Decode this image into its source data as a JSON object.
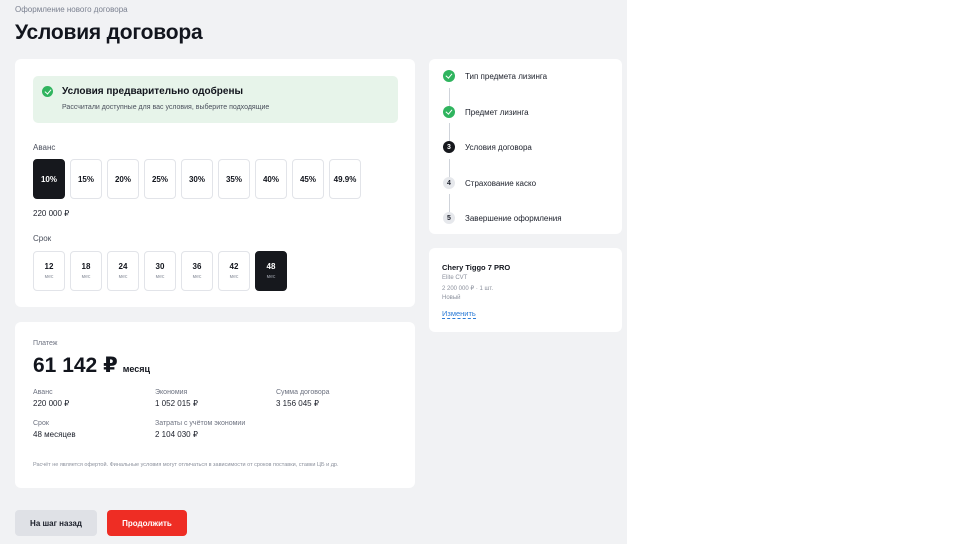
{
  "breadcrumb": "Оформление нового договора",
  "page_title": "Условия договора",
  "approval": {
    "title": "Условия предварительно одобрены",
    "subtitle": "Рассчитали доступные для вас условия, выберите подходящие"
  },
  "advance": {
    "label": "Аванс",
    "options": [
      "10%",
      "15%",
      "20%",
      "25%",
      "30%",
      "35%",
      "40%",
      "45%",
      "49.9%"
    ],
    "selected": "10%",
    "amount": "220 000 ₽"
  },
  "term": {
    "label": "Срок",
    "unit": "мес",
    "options": [
      "12",
      "18",
      "24",
      "30",
      "36",
      "42",
      "48"
    ],
    "selected": "48"
  },
  "payment": {
    "label": "Платеж",
    "amount": "61 142 ₽",
    "period": "месяц",
    "details": [
      {
        "key": "Аванс",
        "value": "220 000 ₽"
      },
      {
        "key": "Экономия",
        "value": "1 052 015 ₽"
      },
      {
        "key": "Сумма договора",
        "value": "3 156 045 ₽"
      },
      {
        "key": "Срок",
        "value": "48 месяцев"
      },
      {
        "key": "Затраты с учётом экономии",
        "value": "2 104 030 ₽"
      }
    ],
    "disclaimer": "Расчёт не является офертой. Финальные условия могут отличаться в зависимости от сроков поставки, ставки ЦБ и др."
  },
  "steps": [
    {
      "num": "1",
      "label": "Тип предмета лизинга",
      "state": "done"
    },
    {
      "num": "2",
      "label": "Предмет лизинга",
      "state": "done"
    },
    {
      "num": "3",
      "label": "Условия договора",
      "state": "current"
    },
    {
      "num": "4",
      "label": "Страхование каско",
      "state": "todo"
    },
    {
      "num": "5",
      "label": "Завершение оформления",
      "state": "todo"
    }
  ],
  "item": {
    "title": "Chery Tiggo 7 PRO",
    "lines": [
      "Elite CVT",
      "2 200 000 ₽ · 1 шт.",
      "Новый"
    ],
    "change_link": "Изменить"
  },
  "buttons": {
    "back": "На шаг назад",
    "next": "Продолжить"
  },
  "colors": {
    "accent": "#ee2d24",
    "success": "#2fb45e",
    "selected": "#16181d",
    "link": "#2b7bd6"
  }
}
